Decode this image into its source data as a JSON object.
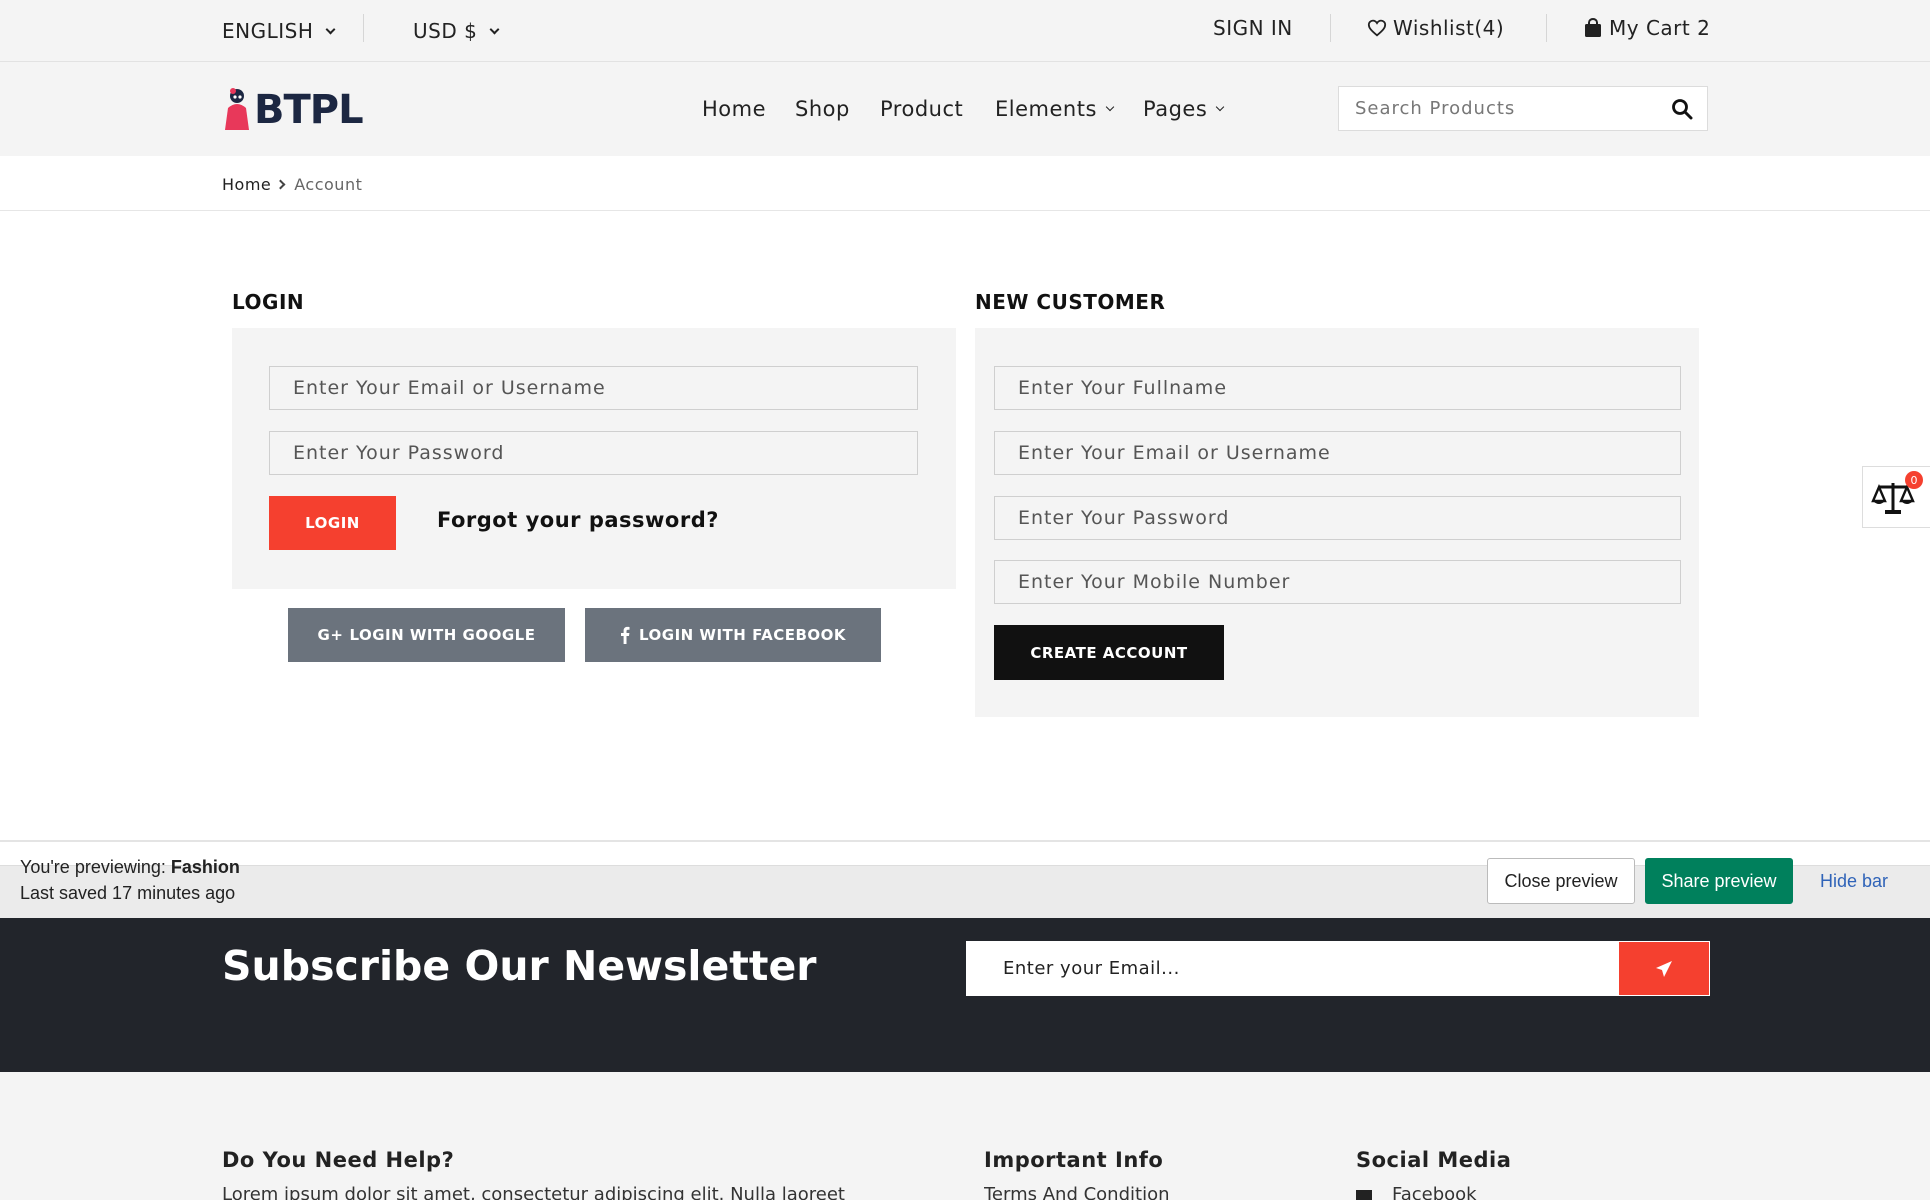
{
  "topbar": {
    "language": "ENGLISH",
    "currency": "USD $",
    "sign_in": "SIGN IN",
    "wishlist": "Wishlist(4)",
    "cart": "My Cart 2"
  },
  "header": {
    "logo_text": "BTPL",
    "nav": {
      "home": "Home",
      "shop": "Shop",
      "product": "Product",
      "elements": "Elements",
      "pages": "Pages"
    },
    "search_placeholder": "Search Products"
  },
  "breadcrumb": {
    "home": "Home",
    "current": "Account"
  },
  "login": {
    "title": "LOGIN",
    "email_placeholder": "Enter Your Email or Username",
    "password_placeholder": "Enter Your Password",
    "login_button": "LOGIN",
    "forgot": "Forgot your password?",
    "google_button": "LOGIN WITH GOOGLE",
    "google_icon_text": "G+",
    "facebook_button": "LOGIN WITH FACEBOOK"
  },
  "register": {
    "title": "NEW CUSTOMER",
    "fullname_placeholder": "Enter Your Fullname",
    "email_placeholder": "Enter Your Email or Username",
    "password_placeholder": "Enter Your Password",
    "mobile_placeholder": "Enter Your Mobile Number",
    "create_button": "CREATE ACCOUNT"
  },
  "compare": {
    "count": "0"
  },
  "preview_bar": {
    "previewing_label": "You're previewing: ",
    "theme_name": "Fashion",
    "last_saved": "Last saved 17 minutes ago",
    "close_button": "Close preview",
    "share_button": "Share preview",
    "hide_link": "Hide bar"
  },
  "newsletter": {
    "title": "Subscribe Our Newsletter",
    "email_placeholder": "Enter your Email..."
  },
  "footer": {
    "help_title": "Do You Need Help?",
    "help_text": "Lorem ipsum dolor sit amet, consectetur adipiscing elit. Nulla laoreet",
    "info_title": "Important Info",
    "info_first_link": "Terms And Condition",
    "social_title": "Social Media",
    "social_first": "Facebook"
  },
  "colors": {
    "accent": "#f5402f",
    "dark": "#22252b",
    "share_green": "#00805c",
    "link_blue": "#2f63b8"
  }
}
